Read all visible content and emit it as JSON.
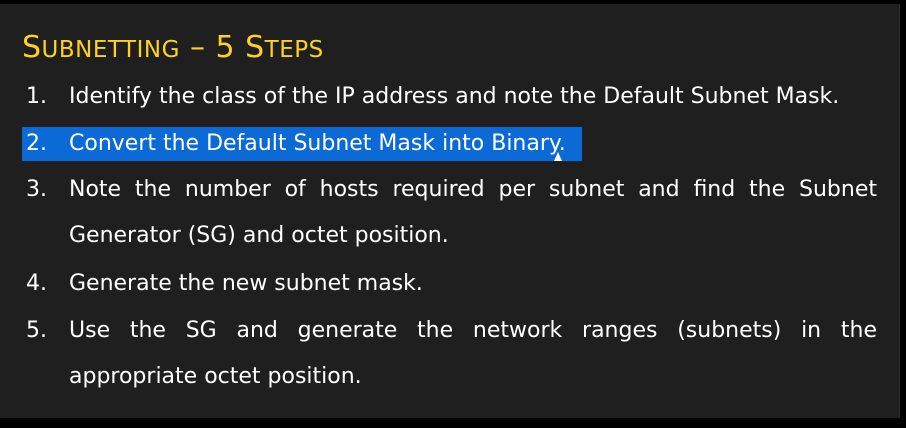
{
  "slide": {
    "title": "Subnetting – 5 Steps",
    "title_parts": {
      "s": "S",
      "ubnetting": "UBNETTING",
      "dash": " – ",
      "five": "5 ",
      "st": "S",
      "teps": "TEPS"
    },
    "colors": {
      "background": "#1f1f1f",
      "title": "#ffd21f",
      "text": "#ffffff",
      "highlight": "#0b6ad6"
    },
    "steps": [
      {
        "number": "1.",
        "text": "Identify the class of the IP address and note the Default Subnet Mask."
      },
      {
        "number": "2.",
        "text": "Convert the Default Subnet Mask into Binary.",
        "selected": true
      },
      {
        "number": "3.",
        "line1": "Note the number of hosts required per subnet and find the Subnet",
        "line2": "Generator (SG) and octet position."
      },
      {
        "number": "4.",
        "text": "Generate the new subnet mask."
      },
      {
        "number": "5.",
        "line1": "Use the SG and generate the network ranges (subnets) in the",
        "line2": "appropriate octet position."
      }
    ]
  }
}
